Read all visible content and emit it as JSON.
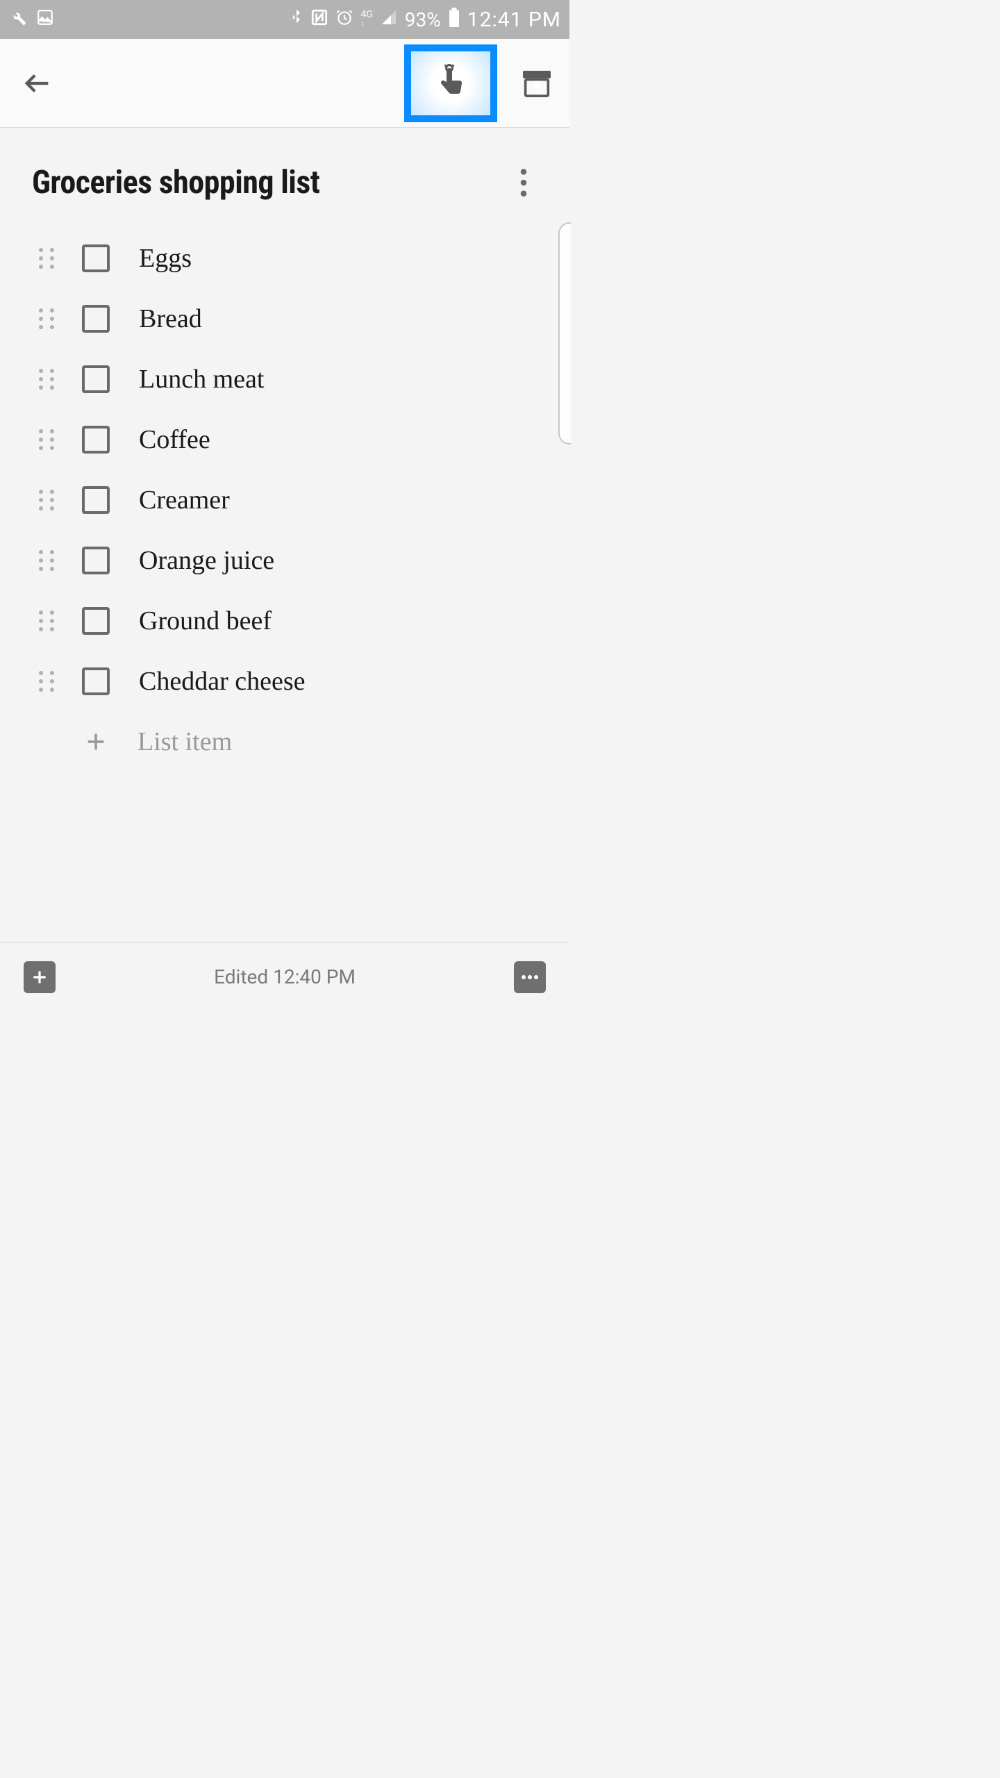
{
  "status": {
    "battery": "93%",
    "time": "12:41 PM",
    "network_label": "4G"
  },
  "header": {
    "highlight_color": "#0a8cff"
  },
  "note": {
    "title": "Groceries shopping list",
    "items": [
      {
        "label": "Eggs",
        "checked": false
      },
      {
        "label": "Bread",
        "checked": false
      },
      {
        "label": "Lunch meat",
        "checked": false
      },
      {
        "label": "Coffee",
        "checked": false
      },
      {
        "label": "Creamer",
        "checked": false
      },
      {
        "label": "Orange juice",
        "checked": false
      },
      {
        "label": "Ground beef",
        "checked": false
      },
      {
        "label": "Cheddar cheese",
        "checked": false
      }
    ],
    "add_placeholder": "List item"
  },
  "footer": {
    "edited_text": "Edited 12:40 PM"
  }
}
